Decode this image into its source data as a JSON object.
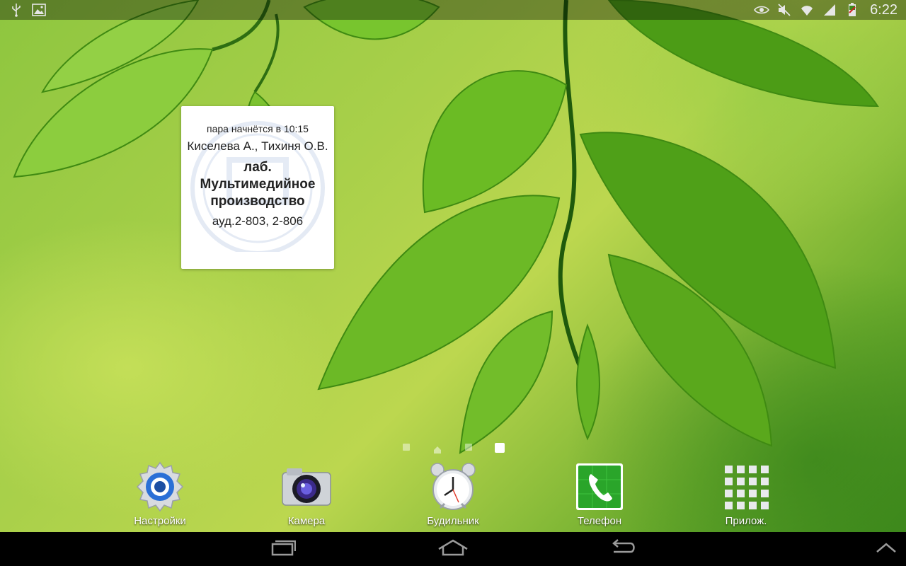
{
  "status_bar": {
    "left_icons": [
      "usb-icon",
      "picture-icon"
    ],
    "right_icons": [
      "smart-stay-eye-icon",
      "mute-icon",
      "wifi-icon",
      "signal-icon",
      "battery-icon"
    ],
    "time": "6:22"
  },
  "widget": {
    "start_time": "пара начнётся в 10:15",
    "teachers": "Киселева А., Тихиня О.В.",
    "subject": "лаб. Мультимедийное производство",
    "room": "ауд.2-803, 2-806"
  },
  "pager": {
    "pages": [
      "page",
      "home",
      "page",
      "page"
    ],
    "active_index": 3
  },
  "dock": [
    {
      "label": "Настройки",
      "icon": "settings-gear-icon"
    },
    {
      "label": "Камера",
      "icon": "camera-icon"
    },
    {
      "label": "Будильник",
      "icon": "alarm-clock-icon"
    },
    {
      "label": "Телефон",
      "icon": "phone-icon"
    },
    {
      "label": "Прилож.",
      "icon": "apps-grid-icon"
    }
  ],
  "nav_bar": [
    "recent-apps-icon",
    "home-icon",
    "back-icon",
    "chevron-up-icon"
  ],
  "colors": {
    "phone_green": "#2aa52a",
    "settings_blue": "#2a6fd6",
    "status_bar_bg": "rgba(0,0,0,0.35)"
  }
}
